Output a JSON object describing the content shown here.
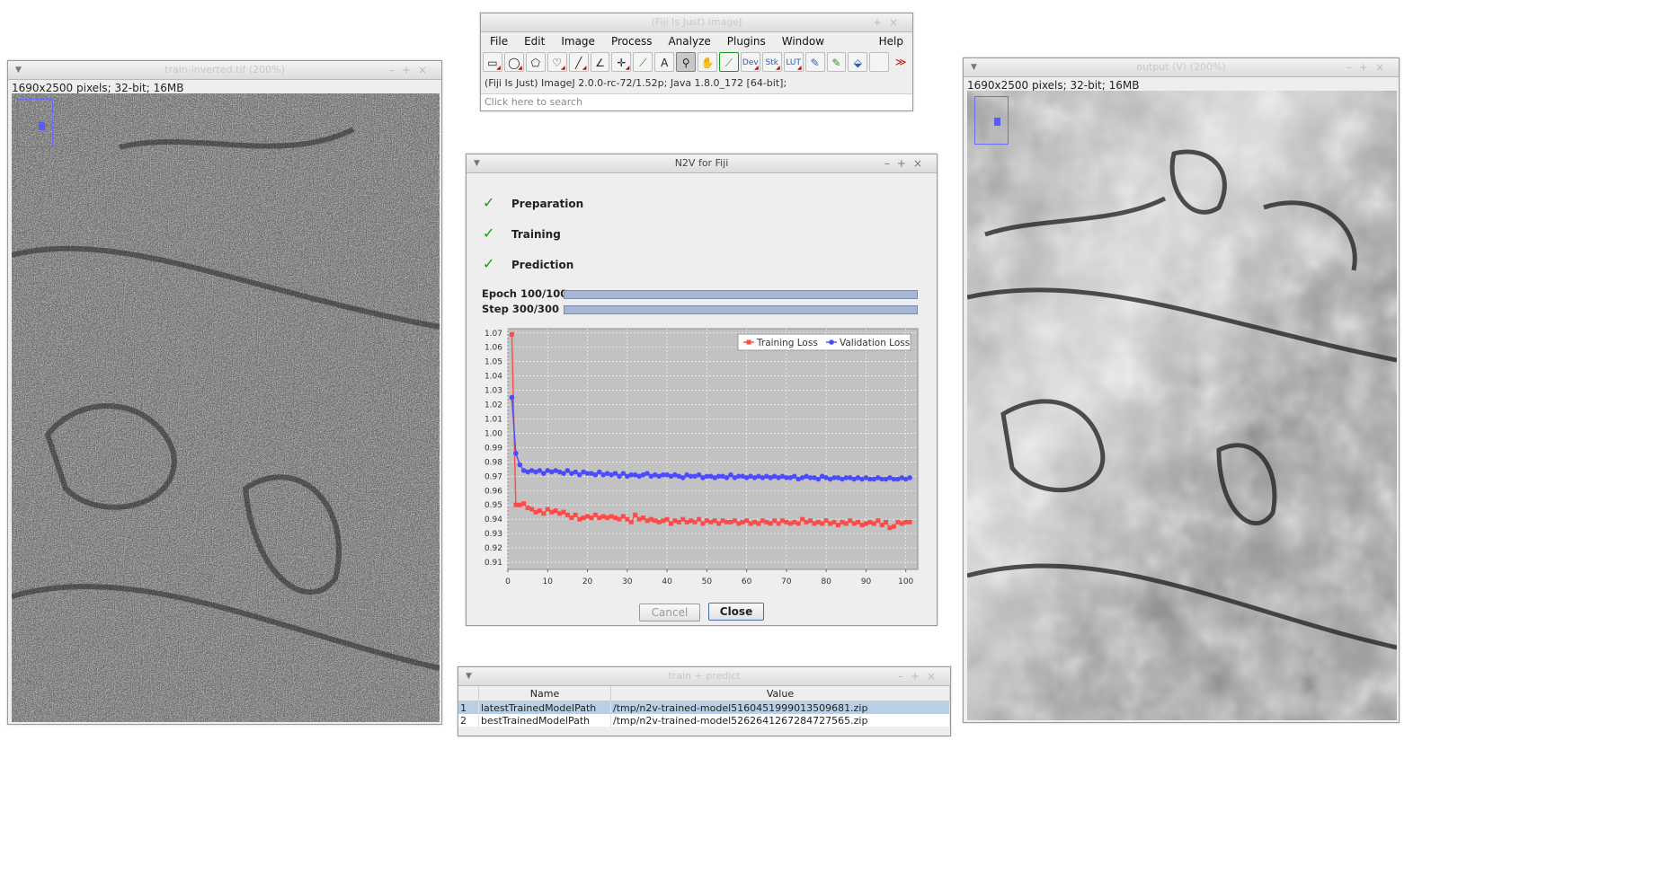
{
  "left_window": {
    "title": "train-inverted.tif (200%)",
    "info": "1690x2500 pixels; 32-bit; 16MB"
  },
  "right_window": {
    "title": "output (V) (200%)",
    "info": "1690x2500 pixels; 32-bit; 16MB"
  },
  "imagej": {
    "title": "(Fiji Is Just) ImageJ",
    "menus": [
      "File",
      "Edit",
      "Image",
      "Process",
      "Analyze",
      "Plugins",
      "Window"
    ],
    "help": "Help",
    "tools": [
      {
        "icon": "rectangle-tool-icon",
        "glyph": "▭"
      },
      {
        "icon": "oval-tool-icon",
        "glyph": "◯"
      },
      {
        "icon": "polygon-tool-icon",
        "glyph": "⬠"
      },
      {
        "icon": "freehand-tool-icon",
        "glyph": "♡"
      },
      {
        "icon": "line-tool-icon",
        "glyph": "╱"
      },
      {
        "icon": "angle-tool-icon",
        "glyph": "∠"
      },
      {
        "icon": "point-tool-icon",
        "glyph": "✛"
      },
      {
        "icon": "wand-tool-icon",
        "glyph": "⚲"
      },
      {
        "icon": "text-tool-icon",
        "glyph": "A"
      },
      {
        "icon": "magnifier-tool-icon",
        "glyph": "🔍"
      },
      {
        "icon": "hand-tool-icon",
        "glyph": "✋"
      },
      {
        "icon": "color-picker-tool-icon",
        "glyph": "⟋"
      },
      {
        "icon": "dev-tool-icon",
        "glyph": "Dev"
      },
      {
        "icon": "stack-tool-icon",
        "glyph": "Stk"
      },
      {
        "icon": "lut-tool-icon",
        "glyph": "LUT"
      },
      {
        "icon": "pencil-tool-icon",
        "glyph": "✎"
      },
      {
        "icon": "brush-tool-icon",
        "glyph": "🖌"
      },
      {
        "icon": "flood-fill-tool-icon",
        "glyph": "⛾"
      },
      {
        "icon": "blank-tool-icon",
        "glyph": ""
      },
      {
        "icon": "more-tools-icon",
        "glyph": "≫"
      }
    ],
    "status": "(Fiji Is Just) ImageJ 2.0.0-rc-72/1.52p; Java 1.8.0_172 [64-bit];",
    "search_placeholder": "Click here to search"
  },
  "n2v": {
    "title": "N2V for Fiji",
    "steps": [
      "Preparation",
      "Training",
      "Prediction"
    ],
    "epoch_label": "Epoch 100/100",
    "step_label": "Step 300/300",
    "epoch_progress": 1.0,
    "step_progress": 1.0,
    "cancel": "Cancel",
    "close": "Close"
  },
  "chart_data": {
    "type": "line",
    "title": "",
    "xlabel": "",
    "ylabel": "",
    "xlim": [
      0,
      103
    ],
    "ylim": [
      0.905,
      1.073
    ],
    "xticks": [
      0,
      10,
      20,
      30,
      40,
      50,
      60,
      70,
      80,
      90,
      100
    ],
    "yticks": [
      0.91,
      0.92,
      0.93,
      0.94,
      0.95,
      0.96,
      0.97,
      0.98,
      0.99,
      1.0,
      1.01,
      1.02,
      1.03,
      1.04,
      1.05,
      1.06,
      1.07
    ],
    "ytick_labels": [
      "0.91",
      "0.92",
      "0.93",
      "0.94",
      "0.95",
      "0.96",
      "0.97",
      "0.98",
      "0.99",
      "1.00",
      "1.01",
      "1.02",
      "1.03",
      "1.04",
      "1.05",
      "1.06",
      "1.07"
    ],
    "grid": true,
    "legend_position": "top-right",
    "series": [
      {
        "name": "Training Loss",
        "color": "#ff4a4a",
        "marker": "square",
        "values": [
          1.069,
          0.95,
          0.95,
          0.951,
          0.948,
          0.947,
          0.945,
          0.946,
          0.944,
          0.947,
          0.945,
          0.946,
          0.944,
          0.945,
          0.943,
          0.941,
          0.943,
          0.94,
          0.941,
          0.942,
          0.941,
          0.943,
          0.941,
          0.942,
          0.941,
          0.942,
          0.941,
          0.94,
          0.942,
          0.94,
          0.938,
          0.943,
          0.94,
          0.941,
          0.939,
          0.94,
          0.939,
          0.938,
          0.939,
          0.94,
          0.937,
          0.939,
          0.938,
          0.94,
          0.938,
          0.939,
          0.938,
          0.94,
          0.937,
          0.939,
          0.938,
          0.939,
          0.937,
          0.939,
          0.938,
          0.938,
          0.939,
          0.937,
          0.938,
          0.939,
          0.937,
          0.938,
          0.937,
          0.939,
          0.938,
          0.937,
          0.939,
          0.937,
          0.939,
          0.938,
          0.937,
          0.938,
          0.937,
          0.94,
          0.938,
          0.939,
          0.937,
          0.938,
          0.937,
          0.939,
          0.937,
          0.938,
          0.936,
          0.938,
          0.937,
          0.939,
          0.937,
          0.938,
          0.936,
          0.937,
          0.938,
          0.937,
          0.939,
          0.936,
          0.938,
          0.934,
          0.935,
          0.938,
          0.937,
          0.938,
          0.938
        ]
      },
      {
        "name": "Validation Loss",
        "color": "#4a4aff",
        "marker": "circle",
        "values": [
          1.025,
          0.986,
          0.978,
          0.974,
          0.973,
          0.974,
          0.973,
          0.974,
          0.972,
          0.974,
          0.973,
          0.974,
          0.973,
          0.972,
          0.974,
          0.972,
          0.973,
          0.971,
          0.973,
          0.972,
          0.972,
          0.971,
          0.973,
          0.971,
          0.972,
          0.971,
          0.972,
          0.97,
          0.972,
          0.97,
          0.971,
          0.971,
          0.97,
          0.971,
          0.972,
          0.97,
          0.971,
          0.97,
          0.971,
          0.971,
          0.97,
          0.971,
          0.97,
          0.969,
          0.971,
          0.97,
          0.97,
          0.971,
          0.969,
          0.97,
          0.97,
          0.969,
          0.97,
          0.97,
          0.969,
          0.971,
          0.969,
          0.97,
          0.97,
          0.969,
          0.97,
          0.969,
          0.97,
          0.969,
          0.97,
          0.969,
          0.97,
          0.969,
          0.97,
          0.969,
          0.969,
          0.97,
          0.968,
          0.969,
          0.97,
          0.969,
          0.969,
          0.968,
          0.97,
          0.969,
          0.968,
          0.969,
          0.969,
          0.968,
          0.969,
          0.969,
          0.968,
          0.969,
          0.968,
          0.969,
          0.968,
          0.968,
          0.969,
          0.968,
          0.968,
          0.969,
          0.968,
          0.968,
          0.969,
          0.968,
          0.969
        ]
      }
    ]
  },
  "results": {
    "title": "train + predict",
    "columns": [
      "",
      "Name",
      "Value"
    ],
    "rows": [
      [
        "1",
        "latestTrainedModelPath",
        "/tmp/n2v-trained-model5160451999013509681.zip"
      ],
      [
        "2",
        "bestTrainedModelPath",
        "/tmp/n2v-trained-model5262641267284727565.zip"
      ]
    ]
  }
}
